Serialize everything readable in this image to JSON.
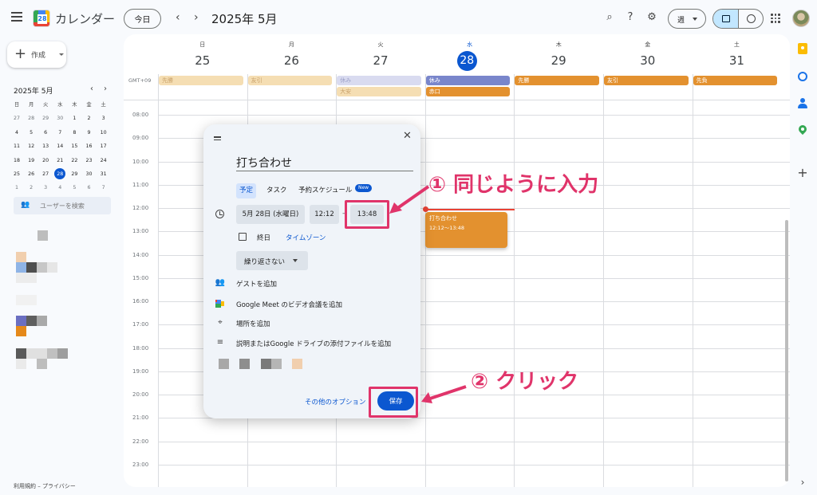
{
  "app": {
    "title": "カレンダー",
    "logo_num": "28",
    "today_label": "今日",
    "current_period": "2025年 5月",
    "view_label": "週"
  },
  "sidebar": {
    "create_label": "作成",
    "mini_month": "2025年 5月",
    "weekday_headers": [
      "日",
      "月",
      "火",
      "水",
      "木",
      "金",
      "土"
    ],
    "weeks": [
      [
        "27",
        "28",
        "29",
        "30",
        "1",
        "2",
        "3"
      ],
      [
        "4",
        "5",
        "6",
        "7",
        "8",
        "9",
        "10"
      ],
      [
        "11",
        "12",
        "13",
        "14",
        "15",
        "16",
        "17"
      ],
      [
        "18",
        "19",
        "20",
        "21",
        "22",
        "23",
        "24"
      ],
      [
        "25",
        "26",
        "27",
        "28",
        "29",
        "30",
        "31"
      ],
      [
        "1",
        "2",
        "3",
        "4",
        "5",
        "6",
        "7"
      ]
    ],
    "people_search_placeholder": "ユーザーを検索",
    "footer": "利用規約 – プライバシー"
  },
  "week": {
    "timezone": "GMT+09",
    "days": [
      {
        "dow": "日",
        "num": "25",
        "today": false
      },
      {
        "dow": "月",
        "num": "26",
        "today": false
      },
      {
        "dow": "火",
        "num": "27",
        "today": false
      },
      {
        "dow": "水",
        "num": "28",
        "today": true
      },
      {
        "dow": "木",
        "num": "29",
        "today": false
      },
      {
        "dow": "金",
        "num": "30",
        "today": false
      },
      {
        "dow": "土",
        "num": "31",
        "today": false
      }
    ],
    "allday_events": [
      {
        "day": 0,
        "row": 0,
        "label": "先勝",
        "color": "#f5deb3",
        "text_color": "#c9a26b"
      },
      {
        "day": 1,
        "row": 0,
        "label": "友引",
        "color": "#f5deb3",
        "text_color": "#c9a26b"
      },
      {
        "day": 2,
        "row": 0,
        "label": "休み",
        "color": "#d9dbf0",
        "text_color": "#9fa3c9"
      },
      {
        "day": 2,
        "row": 1,
        "label": "大安",
        "color": "#f5deb3",
        "text_color": "#c9a26b"
      },
      {
        "day": 3,
        "row": 0,
        "label": "休み",
        "color": "#7986cb",
        "text_color": "#ffffff"
      },
      {
        "day": 3,
        "row": 1,
        "label": "赤口",
        "color": "#e3912f",
        "text_color": "#ffffff"
      },
      {
        "day": 4,
        "row": 0,
        "label": "先勝",
        "color": "#e3912f",
        "text_color": "#ffffff"
      },
      {
        "day": 5,
        "row": 0,
        "label": "友引",
        "color": "#e3912f",
        "text_color": "#ffffff"
      },
      {
        "day": 6,
        "row": 0,
        "label": "先負",
        "color": "#e3912f",
        "text_color": "#ffffff"
      }
    ],
    "hours": [
      "08:00",
      "09:00",
      "10:00",
      "11:00",
      "12:00",
      "13:00",
      "14:00",
      "15:00",
      "16:00",
      "17:00",
      "18:00",
      "19:00",
      "20:00",
      "21:00",
      "22:00",
      "23:00"
    ],
    "event": {
      "title": "打ち合わせ",
      "time": "12:12～13:48",
      "color": "#e3912f"
    }
  },
  "dialog": {
    "title_value": "打ち合わせ",
    "tabs": [
      "予定",
      "タスク",
      "予約スケジュール"
    ],
    "new_badge": "New",
    "date": "5月 28日 (水曜日)",
    "start_time": "12:12",
    "end_time": "13:48",
    "dash": "–",
    "allday_label": "終日",
    "timezone_link": "タイムゾーン",
    "repeat": "繰り返さない",
    "options": [
      {
        "icon": "guests-icon",
        "label": "ゲストを追加"
      },
      {
        "icon": "google-meet-icon",
        "label": "Google Meet のビデオ会議を追加"
      },
      {
        "icon": "location-icon",
        "label": "場所を追加"
      },
      {
        "icon": "description-icon",
        "label": "説明またはGoogle ドライブの添付ファイルを追加"
      }
    ],
    "more_options": "その他のオプション",
    "save": "保存"
  },
  "annotations": {
    "step1": "① 同じように入力",
    "step2": "② クリック",
    "color": "#e0346a"
  }
}
